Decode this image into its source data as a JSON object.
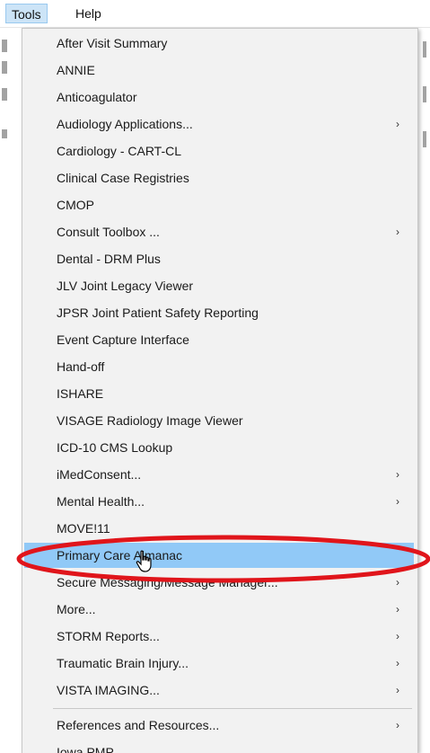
{
  "menubar": {
    "items": [
      {
        "label": "Tools"
      },
      {
        "label": "Help"
      }
    ]
  },
  "menu": {
    "items": [
      {
        "label": "After Visit Summary",
        "submenu": false
      },
      {
        "label": "ANNIE",
        "submenu": false
      },
      {
        "label": "Anticoagulator",
        "submenu": false
      },
      {
        "label": "Audiology Applications...",
        "submenu": true
      },
      {
        "label": "Cardiology - CART-CL",
        "submenu": false
      },
      {
        "label": "Clinical Case Registries",
        "submenu": false
      },
      {
        "label": "CMOP",
        "submenu": false
      },
      {
        "label": "Consult Toolbox ...",
        "submenu": true
      },
      {
        "label": "Dental - DRM Plus",
        "submenu": false
      },
      {
        "label": "JLV Joint Legacy Viewer",
        "submenu": false
      },
      {
        "label": "JPSR Joint Patient Safety Reporting",
        "submenu": false
      },
      {
        "label": "Event Capture Interface",
        "submenu": false
      },
      {
        "label": "Hand-off",
        "submenu": false
      },
      {
        "label": "ISHARE",
        "submenu": false
      },
      {
        "label": "VISAGE Radiology Image Viewer",
        "submenu": false
      },
      {
        "label": "ICD-10 CMS Lookup",
        "submenu": false
      },
      {
        "label": "iMedConsent...",
        "submenu": true
      },
      {
        "label": "Mental Health...",
        "submenu": true
      },
      {
        "label": "MOVE!11",
        "submenu": false
      },
      {
        "label": "Primary Care Almanac",
        "submenu": false,
        "highlighted": true
      },
      {
        "label": "Secure Messaging/Message Manager...",
        "submenu": true
      },
      {
        "label": "More...",
        "submenu": true
      },
      {
        "label": "STORM Reports...",
        "submenu": true
      },
      {
        "label": "Traumatic Brain Injury...",
        "submenu": true
      },
      {
        "label": "VISTA IMAGING...",
        "submenu": true
      },
      {
        "label": "References and Resources...",
        "submenu": true
      },
      {
        "label": "Iowa PMP",
        "submenu": false
      }
    ],
    "arrow_glyph": "›"
  },
  "colors": {
    "highlight": "#91c9f7",
    "annotation_ellipse": "#e0151b",
    "menubar_active": "#cce4f7"
  },
  "icons": {
    "cursor": "hand-pointer-icon"
  }
}
